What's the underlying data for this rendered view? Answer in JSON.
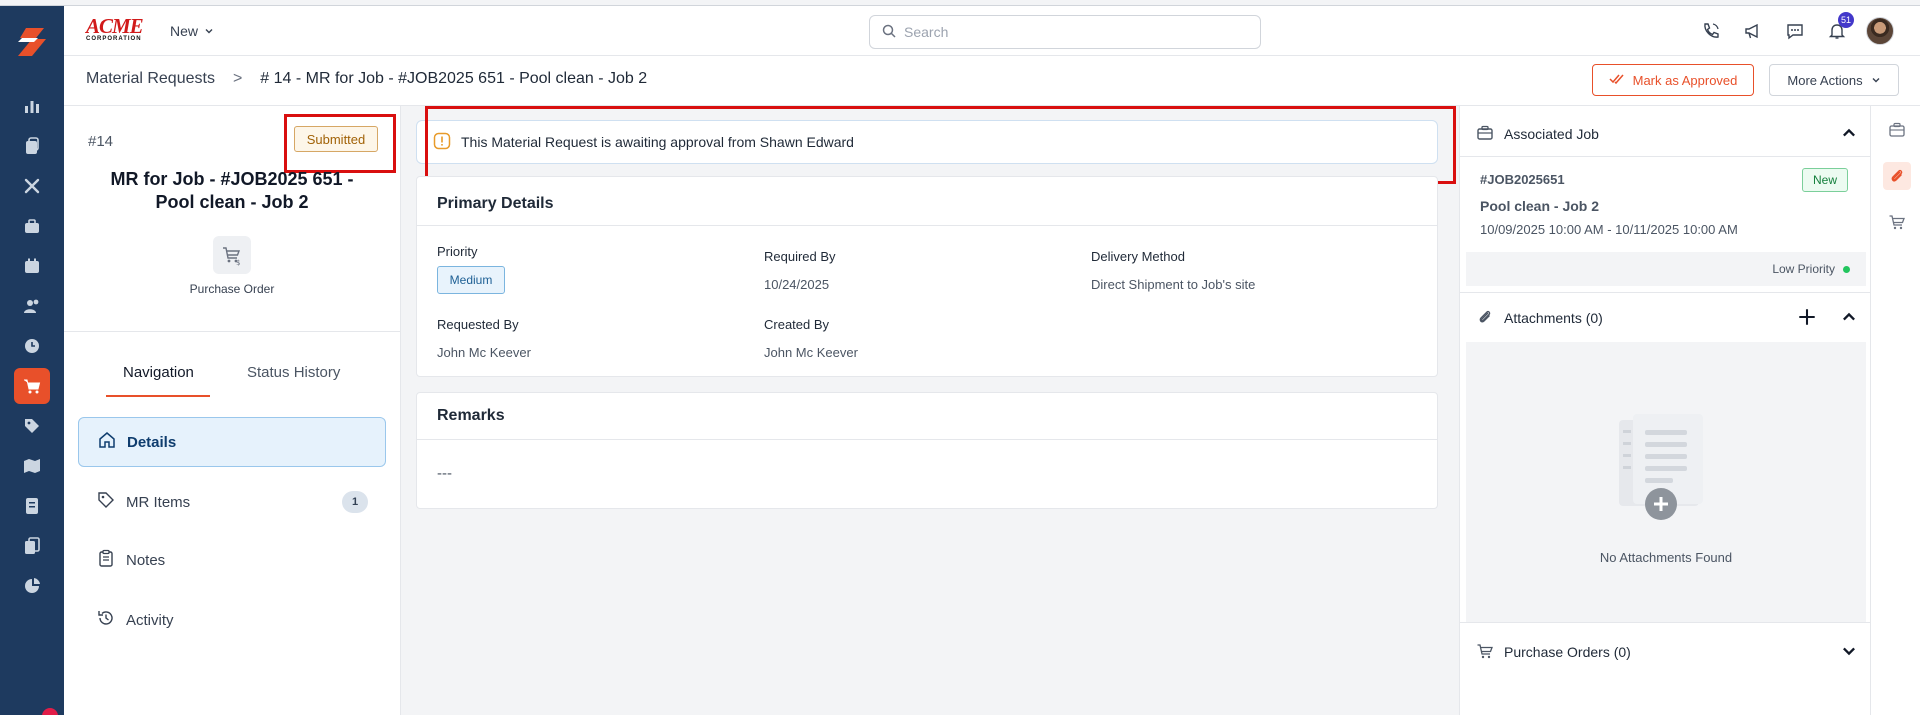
{
  "header": {
    "brand_name": "ACME",
    "brand_sub": "CORPORATION",
    "new_label": "New",
    "search_placeholder": "Search",
    "notification_count": "51"
  },
  "rail": {
    "items": [
      "logo",
      "dashboard-icon",
      "dispatch-icon",
      "tools-icon",
      "jobs-icon",
      "calendar-icon",
      "customers-icon",
      "timesheet-icon",
      "cart-icon",
      "pricebook-icon",
      "map-icon",
      "invoice-icon",
      "documents-icon",
      "reports-icon"
    ],
    "active": "cart-icon"
  },
  "breadcrumb": {
    "parent": "Material Requests",
    "separator": ">",
    "current": "# 14 - MR for Job - #JOB2025 651 - Pool clean - Job 2"
  },
  "actions": {
    "approve_label": "Mark as Approved",
    "more_label": "More Actions"
  },
  "summary": {
    "number": "#14",
    "status": "Submitted",
    "title": "MR for Job - #JOB2025 651 - Pool clean - Job 2",
    "type_label": "Purchase Order"
  },
  "tabs": {
    "navigation": "Navigation",
    "status_history": "Status History"
  },
  "nav_items": [
    {
      "label": "Details",
      "active": true
    },
    {
      "label": "MR Items",
      "count": "1"
    },
    {
      "label": "Notes"
    },
    {
      "label": "Activity"
    }
  ],
  "alert": {
    "text": "This Material Request is awaiting approval from Shawn Edward"
  },
  "primary_details": {
    "title": "Primary Details",
    "priority_label": "Priority",
    "priority_value": "Medium",
    "required_by_label": "Required By",
    "required_by_value": "10/24/2025",
    "delivery_label": "Delivery Method",
    "delivery_value": "Direct Shipment to Job's site",
    "requested_by_label": "Requested By",
    "requested_by_value": "John Mc Keever",
    "created_by_label": "Created By",
    "created_by_value": "John Mc Keever"
  },
  "remarks": {
    "title": "Remarks",
    "value": "---"
  },
  "associated_job": {
    "title": "Associated Job",
    "job_id": "#JOB2025651",
    "status": "New",
    "name": "Pool clean - Job 2",
    "dates": "10/09/2025 10:00 AM - 10/11/2025 10:00 AM",
    "priority": "Low Priority"
  },
  "attachments": {
    "title": "Attachments (0)",
    "empty_text": "No Attachments Found"
  },
  "purchase_orders": {
    "title": "Purchase Orders (0)"
  },
  "colors": {
    "brand_orange": "#e8502a",
    "rail_navy": "#1e3a5f",
    "highlight_red": "#d90f0f"
  }
}
